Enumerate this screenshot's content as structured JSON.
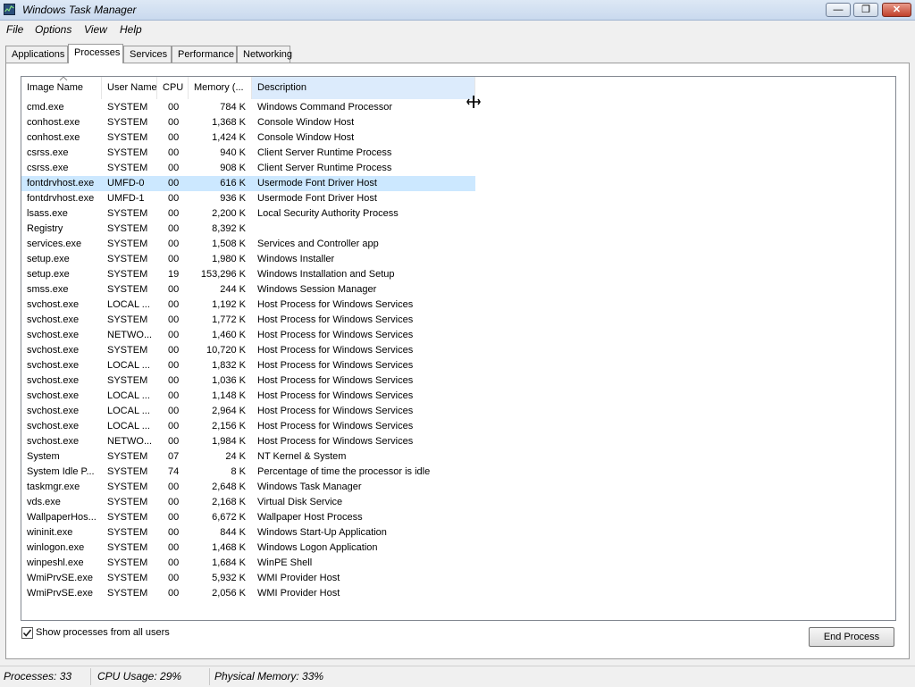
{
  "window": {
    "title": "Windows Task Manager",
    "minimize_glyph": "—",
    "maximize_glyph": "❐",
    "close_glyph": "✕"
  },
  "menu": [
    "File",
    "Options",
    "View",
    "Help"
  ],
  "tabs": [
    {
      "label": "Applications",
      "active": false
    },
    {
      "label": "Processes",
      "active": true
    },
    {
      "label": "Services",
      "active": false
    },
    {
      "label": "Performance",
      "active": false
    },
    {
      "label": "Networking",
      "active": false
    }
  ],
  "columns": {
    "image_name": "Image Name",
    "user_name": "User Name",
    "cpu": "CPU",
    "memory": "Memory (...",
    "description": "Description"
  },
  "sorted_column": "image_name",
  "processes": [
    {
      "image": "cmd.exe",
      "user": "SYSTEM",
      "cpu": "00",
      "memory": "784 K",
      "description": "Windows Command Processor",
      "selected": false
    },
    {
      "image": "conhost.exe",
      "user": "SYSTEM",
      "cpu": "00",
      "memory": "1,368 K",
      "description": "Console Window Host",
      "selected": false
    },
    {
      "image": "conhost.exe",
      "user": "SYSTEM",
      "cpu": "00",
      "memory": "1,424 K",
      "description": "Console Window Host",
      "selected": false
    },
    {
      "image": "csrss.exe",
      "user": "SYSTEM",
      "cpu": "00",
      "memory": "940 K",
      "description": "Client Server Runtime Process",
      "selected": false
    },
    {
      "image": "csrss.exe",
      "user": "SYSTEM",
      "cpu": "00",
      "memory": "908 K",
      "description": "Client Server Runtime Process",
      "selected": false
    },
    {
      "image": "fontdrvhost.exe",
      "user": "UMFD-0",
      "cpu": "00",
      "memory": "616 K",
      "description": "Usermode Font Driver Host",
      "selected": true
    },
    {
      "image": "fontdrvhost.exe",
      "user": "UMFD-1",
      "cpu": "00",
      "memory": "936 K",
      "description": "Usermode Font Driver Host",
      "selected": false
    },
    {
      "image": "lsass.exe",
      "user": "SYSTEM",
      "cpu": "00",
      "memory": "2,200 K",
      "description": "Local Security Authority Process",
      "selected": false
    },
    {
      "image": "Registry",
      "user": "SYSTEM",
      "cpu": "00",
      "memory": "8,392 K",
      "description": "",
      "selected": false
    },
    {
      "image": "services.exe",
      "user": "SYSTEM",
      "cpu": "00",
      "memory": "1,508 K",
      "description": "Services and Controller app",
      "selected": false
    },
    {
      "image": "setup.exe",
      "user": "SYSTEM",
      "cpu": "00",
      "memory": "1,980 K",
      "description": "Windows Installer",
      "selected": false
    },
    {
      "image": "setup.exe",
      "user": "SYSTEM",
      "cpu": "19",
      "memory": "153,296 K",
      "description": "Windows Installation and Setup",
      "selected": false
    },
    {
      "image": "smss.exe",
      "user": "SYSTEM",
      "cpu": "00",
      "memory": "244 K",
      "description": "Windows Session Manager",
      "selected": false
    },
    {
      "image": "svchost.exe",
      "user": "LOCAL ...",
      "cpu": "00",
      "memory": "1,192 K",
      "description": "Host Process for Windows Services",
      "selected": false
    },
    {
      "image": "svchost.exe",
      "user": "SYSTEM",
      "cpu": "00",
      "memory": "1,772 K",
      "description": "Host Process for Windows Services",
      "selected": false
    },
    {
      "image": "svchost.exe",
      "user": "NETWO...",
      "cpu": "00",
      "memory": "1,460 K",
      "description": "Host Process for Windows Services",
      "selected": false
    },
    {
      "image": "svchost.exe",
      "user": "SYSTEM",
      "cpu": "00",
      "memory": "10,720 K",
      "description": "Host Process for Windows Services",
      "selected": false
    },
    {
      "image": "svchost.exe",
      "user": "LOCAL ...",
      "cpu": "00",
      "memory": "1,832 K",
      "description": "Host Process for Windows Services",
      "selected": false
    },
    {
      "image": "svchost.exe",
      "user": "SYSTEM",
      "cpu": "00",
      "memory": "1,036 K",
      "description": "Host Process for Windows Services",
      "selected": false
    },
    {
      "image": "svchost.exe",
      "user": "LOCAL ...",
      "cpu": "00",
      "memory": "1,148 K",
      "description": "Host Process for Windows Services",
      "selected": false
    },
    {
      "image": "svchost.exe",
      "user": "LOCAL ...",
      "cpu": "00",
      "memory": "2,964 K",
      "description": "Host Process for Windows Services",
      "selected": false
    },
    {
      "image": "svchost.exe",
      "user": "LOCAL ...",
      "cpu": "00",
      "memory": "2,156 K",
      "description": "Host Process for Windows Services",
      "selected": false
    },
    {
      "image": "svchost.exe",
      "user": "NETWO...",
      "cpu": "00",
      "memory": "1,984 K",
      "description": "Host Process for Windows Services",
      "selected": false
    },
    {
      "image": "System",
      "user": "SYSTEM",
      "cpu": "07",
      "memory": "24 K",
      "description": "NT Kernel & System",
      "selected": false
    },
    {
      "image": "System Idle P...",
      "user": "SYSTEM",
      "cpu": "74",
      "memory": "8 K",
      "description": "Percentage of time the processor is idle",
      "selected": false
    },
    {
      "image": "taskmgr.exe",
      "user": "SYSTEM",
      "cpu": "00",
      "memory": "2,648 K",
      "description": "Windows Task Manager",
      "selected": false
    },
    {
      "image": "vds.exe",
      "user": "SYSTEM",
      "cpu": "00",
      "memory": "2,168 K",
      "description": "Virtual Disk Service",
      "selected": false
    },
    {
      "image": "WallpaperHos...",
      "user": "SYSTEM",
      "cpu": "00",
      "memory": "6,672 K",
      "description": "Wallpaper Host Process",
      "selected": false
    },
    {
      "image": "wininit.exe",
      "user": "SYSTEM",
      "cpu": "00",
      "memory": "844 K",
      "description": "Windows Start-Up Application",
      "selected": false
    },
    {
      "image": "winlogon.exe",
      "user": "SYSTEM",
      "cpu": "00",
      "memory": "1,468 K",
      "description": "Windows Logon Application",
      "selected": false
    },
    {
      "image": "winpeshl.exe",
      "user": "SYSTEM",
      "cpu": "00",
      "memory": "1,684 K",
      "description": "WinPE Shell",
      "selected": false
    },
    {
      "image": "WmiPrvSE.exe",
      "user": "SYSTEM",
      "cpu": "00",
      "memory": "5,932 K",
      "description": "WMI Provider Host",
      "selected": false
    },
    {
      "image": "WmiPrvSE.exe",
      "user": "SYSTEM",
      "cpu": "00",
      "memory": "2,056 K",
      "description": "WMI Provider Host",
      "selected": false
    }
  ],
  "show_all_users": {
    "label": "Show processes from all users",
    "checked": true
  },
  "end_process_label": "End Process",
  "status": {
    "processes": "Processes: 33",
    "cpu_usage": "CPU Usage: 29%",
    "physical_memory": "Physical Memory: 33%"
  },
  "icons": {
    "app": "task-manager-icon",
    "sort": "sort-ascending-icon",
    "cursor": "column-resize-cursor-icon",
    "check": "checkmark-icon"
  },
  "colors": {
    "selection": "#cce8ff",
    "sorted_header": "#dcebfc",
    "titlebar": "#dde8f5",
    "close_button": "#c0402b"
  }
}
